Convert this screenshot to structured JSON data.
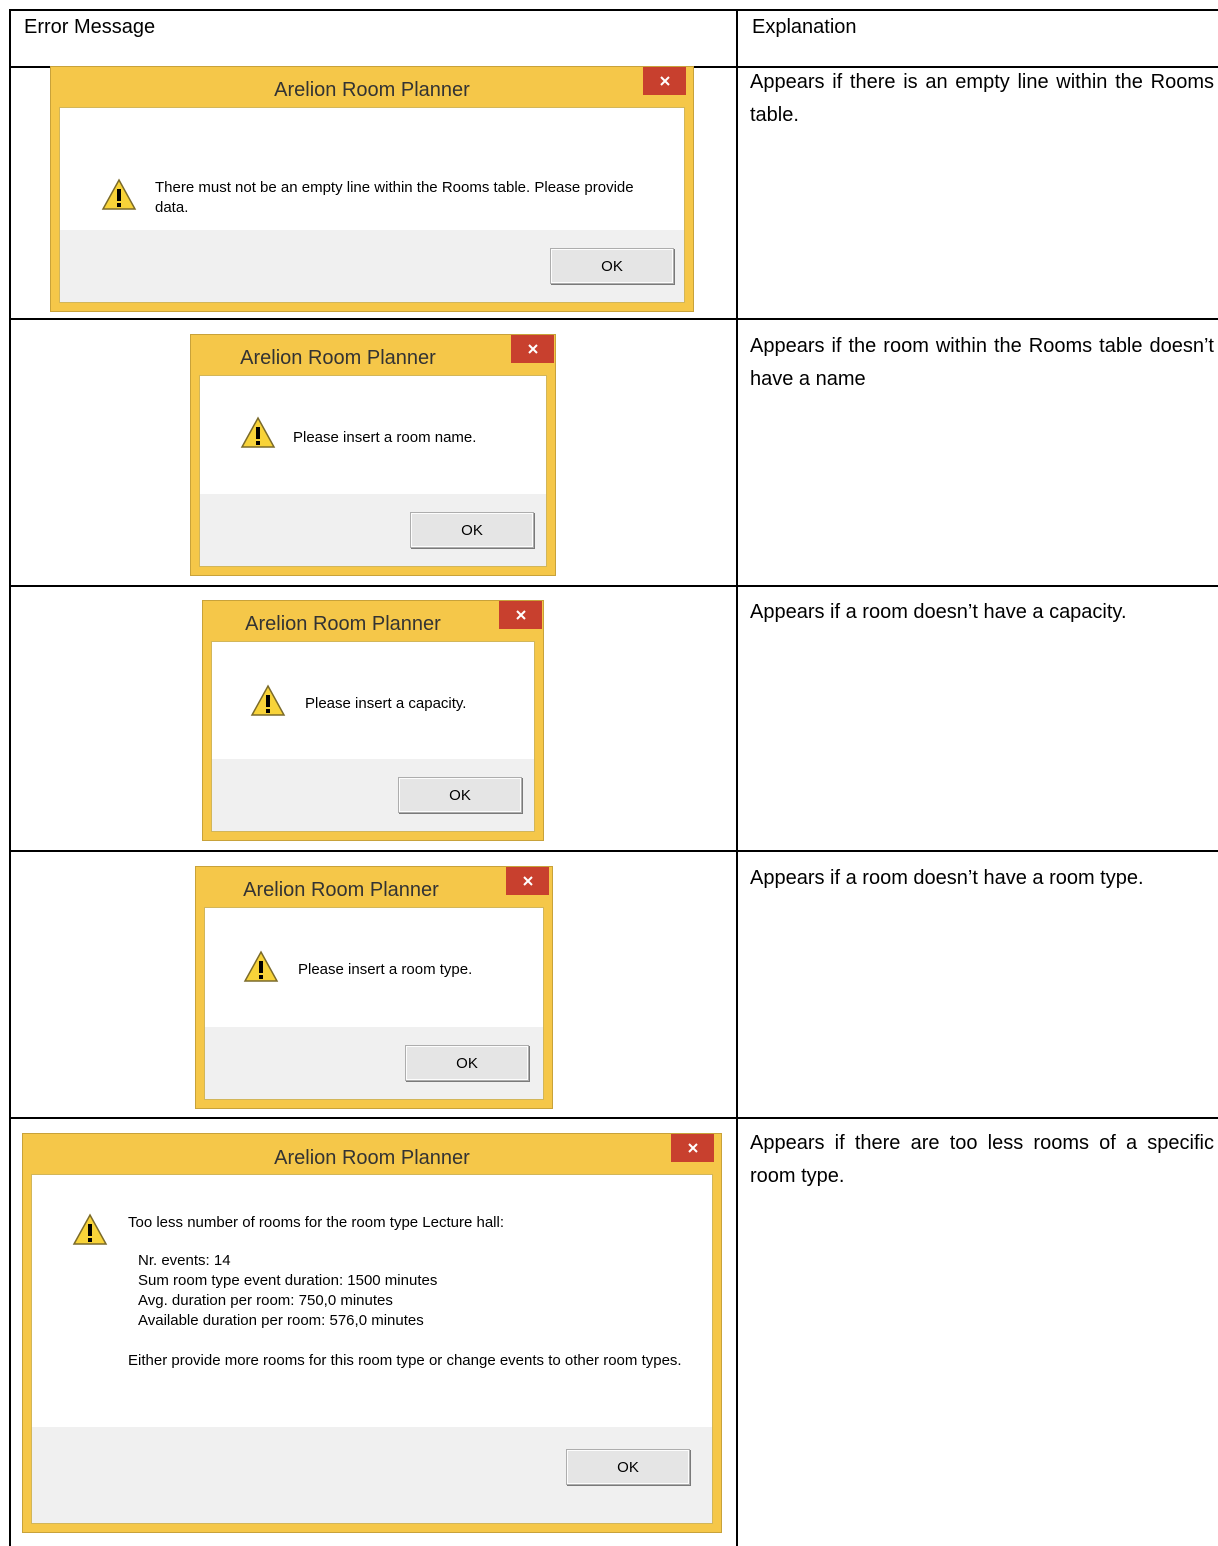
{
  "table": {
    "headers": {
      "error_message": "Error Message",
      "explanation": "Explanation"
    },
    "rows": [
      {
        "explanation": "Appears if there is an empty line within the Rooms table."
      },
      {
        "explanation": "Appears if the room within the Rooms table doesn’t have a name"
      },
      {
        "explanation": "Appears if a room doesn’t have a capacity."
      },
      {
        "explanation": "Appears if a room doesn’t have a room type."
      },
      {
        "explanation": "Appears if there are too less rooms of a specific room type."
      }
    ]
  },
  "dialogs": [
    {
      "title": "Arelion Room Planner",
      "message": "There must not be an empty line within the Rooms table. Please provide data.",
      "ok": "OK"
    },
    {
      "title": "Arelion Room Planner",
      "message": "Please insert a room name.",
      "ok": "OK"
    },
    {
      "title": "Arelion Room Planner",
      "message": "Please insert a capacity.",
      "ok": "OK"
    },
    {
      "title": "Arelion Room Planner",
      "message": "Please insert a room type.",
      "ok": "OK"
    },
    {
      "title": "Arelion Room Planner",
      "message_intro": "Too less number of rooms for the room type Lecture hall:",
      "details": [
        "Nr. events: 14",
        "Sum room type event duration: 1500 minutes",
        "Avg. duration per room: 750,0 minutes",
        "Available duration per room: 576,0 minutes"
      ],
      "message_outro": "Either provide more rooms for this room type or change events to other room types.",
      "ok": "OK"
    }
  ],
  "colors": {
    "dialog_frame": "#f5c749",
    "close_button": "#c8402e",
    "footer": "#f0f0f0"
  },
  "icons": {
    "warning": "warning-icon",
    "close": "close-icon"
  }
}
